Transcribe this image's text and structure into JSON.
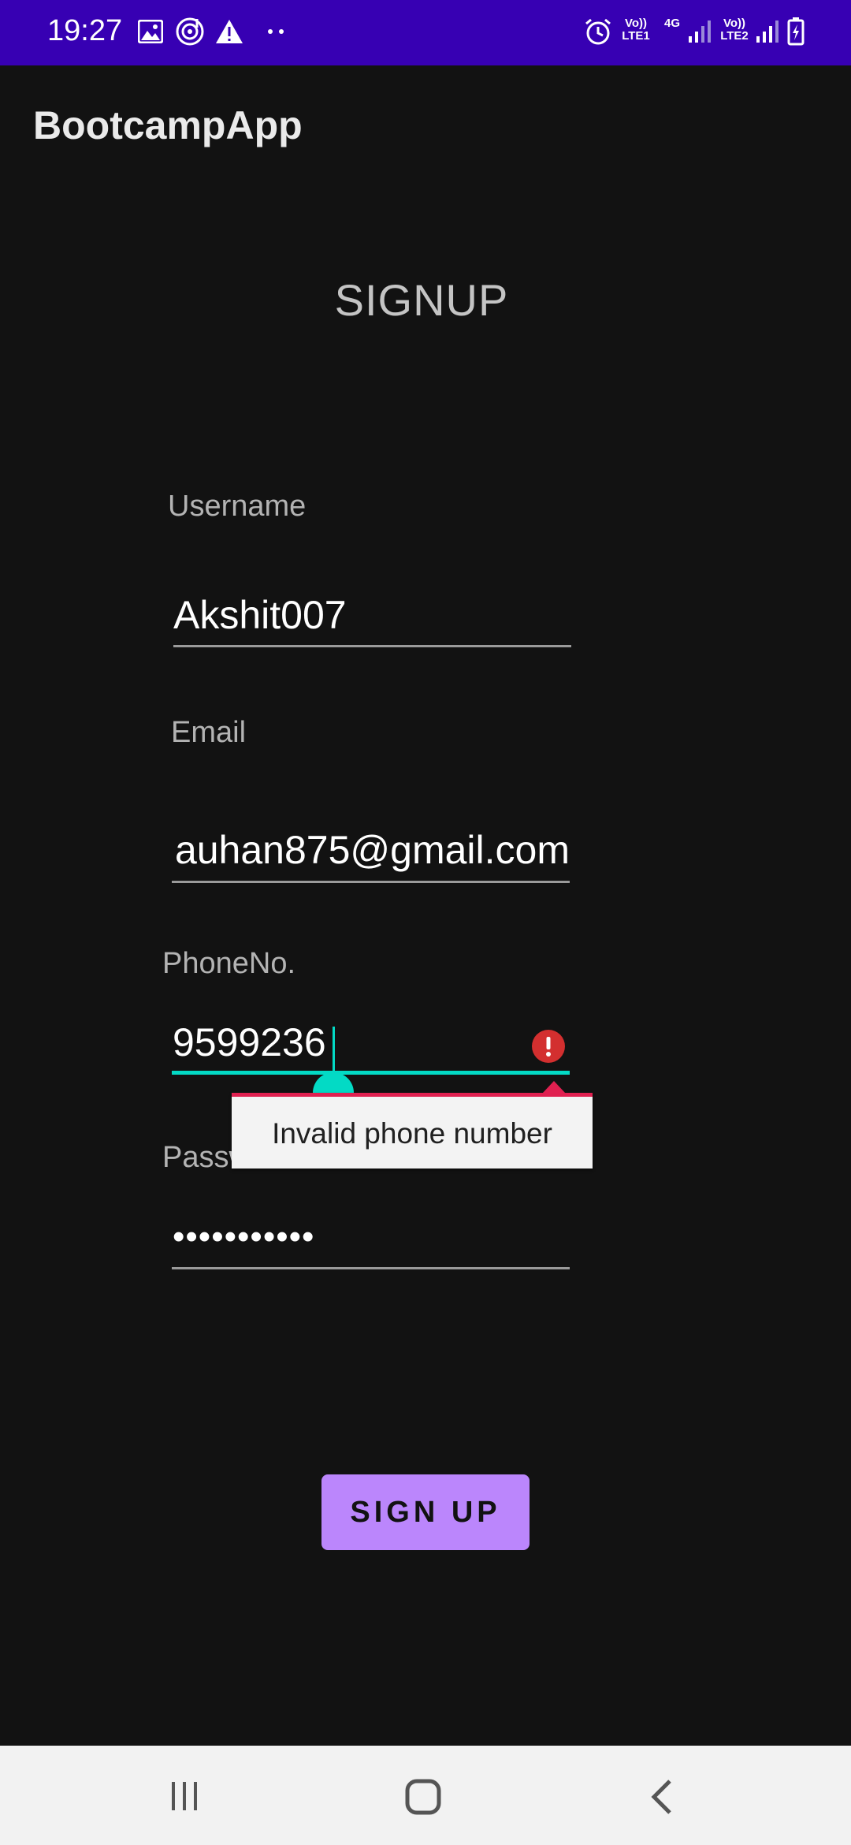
{
  "status_bar": {
    "time": "19:27",
    "network1": "Vo)) LTE1",
    "network1_top": "Vo))",
    "network1_bottom": "LTE1",
    "network_type": "4G",
    "network2_top": "Vo))",
    "network2_bottom": "LTE2",
    "icons": [
      "gallery-icon",
      "music-icon",
      "warning-icon",
      "more-dots-icon",
      "alarm-icon",
      "signal-icon",
      "battery-charging-icon"
    ]
  },
  "app_bar": {
    "title": "BootcampApp"
  },
  "form": {
    "title": "SIGNUP",
    "username": {
      "label": "Username",
      "value": "Akshit007"
    },
    "email": {
      "label": "Email",
      "value": "auhan875@gmail.com"
    },
    "phone": {
      "label": "PhoneNo.",
      "value": "9599236",
      "error": "Invalid phone number"
    },
    "password": {
      "label": "Password",
      "value": "•••••••••••"
    }
  },
  "signup_button": {
    "label": "SIGN UP"
  },
  "colors": {
    "status_bar": "#3700b3",
    "background": "#121212",
    "accent": "#03dac5",
    "error": "#e02020",
    "button": "#bb86fc"
  },
  "nav_bar": {
    "icons": [
      "recent-apps-icon",
      "home-icon",
      "back-icon"
    ]
  }
}
